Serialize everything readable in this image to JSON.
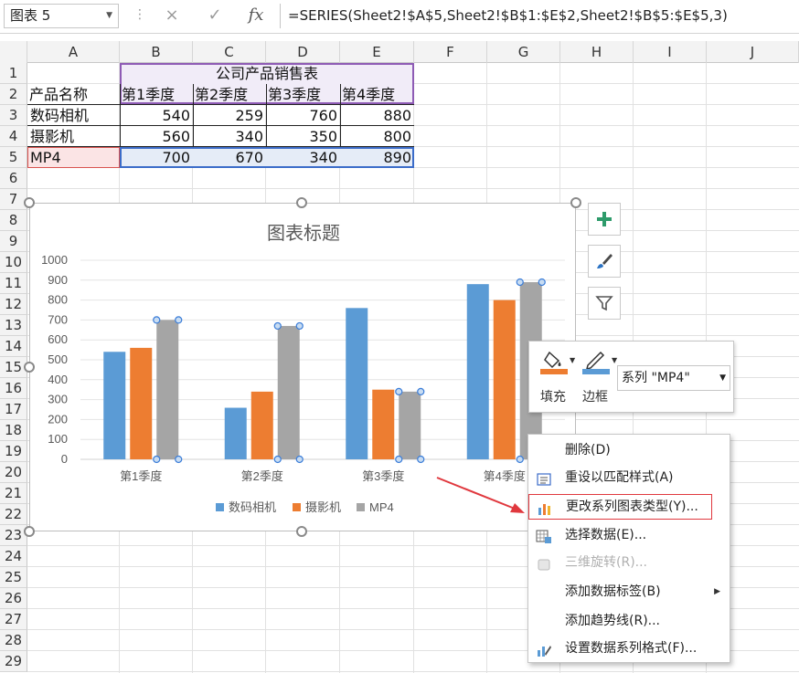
{
  "formula_bar": {
    "name_box": "图表 5",
    "formula": "=SERIES(Sheet2!$A$5,Sheet2!$B$1:$E$2,Sheet2!$B$5:$E$5,3)",
    "cancel_icon": "×",
    "enter_icon": "✓",
    "fx_icon": "fx"
  },
  "columns": [
    "A",
    "B",
    "C",
    "D",
    "E",
    "F",
    "G",
    "H",
    "I",
    "J"
  ],
  "rows": [
    "1",
    "2",
    "3",
    "4",
    "5",
    "6",
    "7",
    "8",
    "9",
    "10",
    "11",
    "12",
    "13",
    "14",
    "15",
    "16",
    "17",
    "18",
    "19",
    "20",
    "21",
    "22",
    "23",
    "24",
    "25",
    "26",
    "27",
    "28",
    "29"
  ],
  "sheet": {
    "table_title": "公司产品销售表",
    "header": [
      "产品名称",
      "第1季度",
      "第2季度",
      "第3季度",
      "第4季度"
    ],
    "data_rows": [
      {
        "name": "数码相机",
        "values": [
          "540",
          "259",
          "760",
          "880"
        ]
      },
      {
        "name": "摄影机",
        "values": [
          "560",
          "340",
          "350",
          "800"
        ]
      },
      {
        "name": "MP4",
        "values": [
          "700",
          "670",
          "340",
          "890"
        ]
      }
    ]
  },
  "chart_data": {
    "type": "bar",
    "title": "图表标题",
    "categories": [
      "第1季度",
      "第2季度",
      "第3季度",
      "第4季度"
    ],
    "series": [
      {
        "name": "数码相机",
        "values": [
          540,
          259,
          760,
          880
        ],
        "color": "#5b9bd5"
      },
      {
        "name": "摄影机",
        "values": [
          560,
          340,
          350,
          800
        ],
        "color": "#ed7d31"
      },
      {
        "name": "MP4",
        "values": [
          700,
          670,
          340,
          890
        ],
        "color": "#a5a5a5"
      }
    ],
    "yticks": [
      "0",
      "100",
      "200",
      "300",
      "400",
      "500",
      "600",
      "700",
      "800",
      "900",
      "1000"
    ],
    "ylim": [
      0,
      1000
    ],
    "legend": "bottom",
    "grid": true
  },
  "side_buttons": [
    {
      "name": "chart-elements-button",
      "icon": "plus-icon"
    },
    {
      "name": "chart-styles-button",
      "icon": "brush-icon"
    },
    {
      "name": "chart-filters-button",
      "icon": "filter-icon"
    }
  ],
  "mini_toolbar": {
    "fill_label": "填充",
    "border_label": "边框",
    "series_select": "系列 \"MP4\"",
    "fill_color": "#ed7d31",
    "border_color": "#5b9bd5"
  },
  "context_menu": {
    "items": [
      {
        "label": "删除(D)",
        "icon": "",
        "disabled": false
      },
      {
        "label": "重设以匹配样式(A)",
        "icon": "reset-style-icon",
        "disabled": false
      },
      {
        "label": "更改系列图表类型(Y)...",
        "icon": "change-chart-type-icon",
        "disabled": false
      },
      {
        "label": "选择数据(E)...",
        "icon": "select-data-icon",
        "disabled": false
      },
      {
        "label": "三维旋转(R)...",
        "icon": "3d-rotation-icon",
        "disabled": true
      },
      {
        "label": "添加数据标签(B)",
        "icon": "",
        "disabled": false
      },
      {
        "label": "添加趋势线(R)...",
        "icon": "",
        "disabled": false
      },
      {
        "label": "设置数据系列格式(F)...",
        "icon": "format-series-icon",
        "disabled": false
      }
    ],
    "highlight_color": "#e0383e"
  }
}
